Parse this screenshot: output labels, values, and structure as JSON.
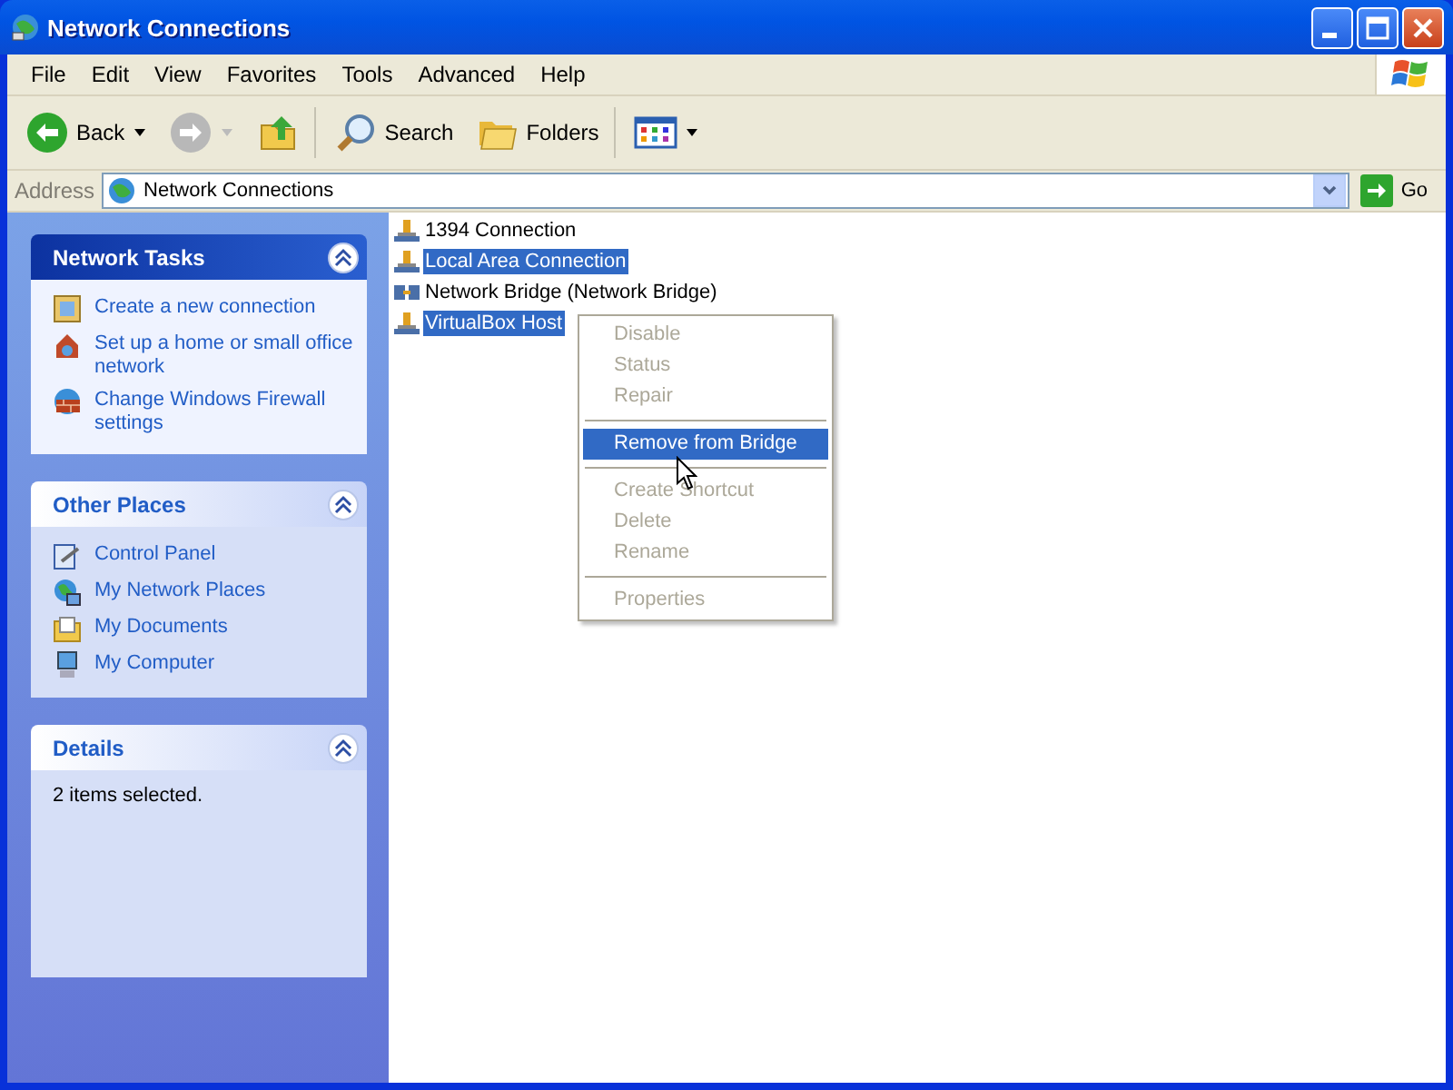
{
  "window": {
    "title": "Network Connections"
  },
  "menu": [
    {
      "label": "File"
    },
    {
      "label": "Edit"
    },
    {
      "label": "View"
    },
    {
      "label": "Favorites"
    },
    {
      "label": "Tools"
    },
    {
      "label": "Advanced"
    },
    {
      "label": "Help"
    }
  ],
  "toolbar": [
    {
      "kind": "back",
      "label": "Back"
    },
    {
      "kind": "forward",
      "disabled": true
    },
    {
      "kind": "up"
    },
    {
      "kind": "search",
      "label": "Search"
    },
    {
      "kind": "folders",
      "label": "Folders"
    },
    {
      "kind": "views"
    }
  ],
  "address": {
    "label": "Address",
    "value": "Network Connections",
    "go": "Go"
  },
  "sidebar": {
    "panels": [
      {
        "title": "Network Tasks",
        "kind": "special",
        "expanded": true,
        "items": [
          {
            "label": "Create a new connection"
          },
          {
            "label": "Set up a home or small office network"
          },
          {
            "label": "Change Windows Firewall settings"
          }
        ]
      },
      {
        "title": "Other Places",
        "kind": "normal",
        "expanded": true,
        "items": [
          {
            "label": "Control Panel"
          },
          {
            "label": "My Network Places"
          },
          {
            "label": "My Documents"
          },
          {
            "label": "My Computer"
          }
        ]
      },
      {
        "title": "Details",
        "kind": "normal",
        "expanded": true,
        "text": "2 items selected."
      }
    ]
  },
  "connections": [
    {
      "label": "1394 Connection",
      "kind": "adapter",
      "selected": false
    },
    {
      "label": "Local Area Connection",
      "kind": "adapter",
      "selected": true
    },
    {
      "label": "Network Bridge (Network Bridge)",
      "kind": "bridge",
      "selected": false
    },
    {
      "label": "VirtualBox Host",
      "kind": "adapter",
      "selected": true
    }
  ],
  "context_menu": [
    {
      "kind": "item",
      "label": "Disable",
      "disabled": true,
      "selected": false
    },
    {
      "kind": "item",
      "label": "Status",
      "disabled": true,
      "selected": false
    },
    {
      "kind": "item",
      "label": "Repair",
      "disabled": true,
      "selected": false
    },
    {
      "kind": "separator"
    },
    {
      "kind": "item",
      "label": "Remove from Bridge",
      "disabled": false,
      "selected": true
    },
    {
      "kind": "separator"
    },
    {
      "kind": "item",
      "label": "Create Shortcut",
      "disabled": true,
      "selected": false
    },
    {
      "kind": "item",
      "label": "Delete",
      "disabled": true,
      "selected": false
    },
    {
      "kind": "item",
      "label": "Rename",
      "disabled": true,
      "selected": false
    },
    {
      "kind": "separator"
    },
    {
      "kind": "item",
      "label": "Properties",
      "disabled": true,
      "selected": false
    }
  ]
}
